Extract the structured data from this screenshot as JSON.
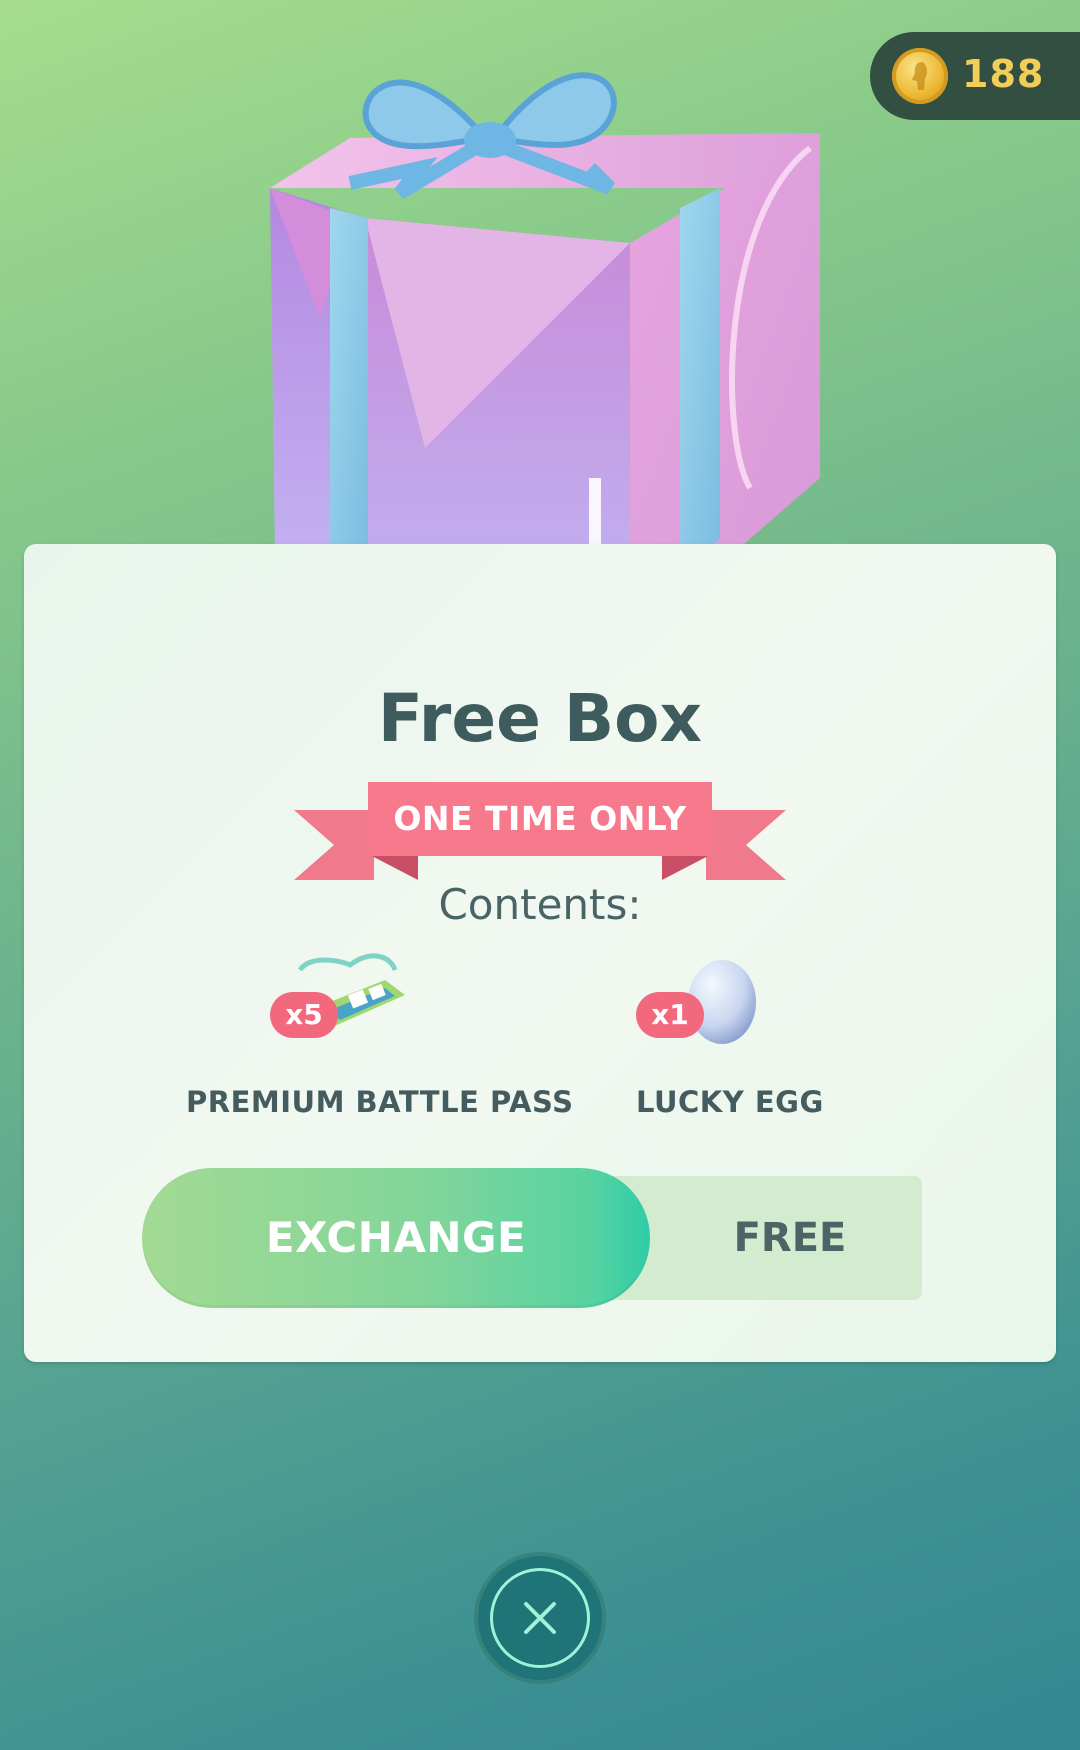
{
  "header": {
    "coins": "188",
    "coin_icon": "pokecoin-icon"
  },
  "offer": {
    "image": "gift-box-illustration",
    "title": "Free Box",
    "banner": "ONE TIME ONLY",
    "contents_label": "Contents:",
    "items": [
      {
        "icon": "battle-pass-icon",
        "quantity": "x5",
        "name": "PREMIUM BATTLE PASS"
      },
      {
        "icon": "lucky-egg-icon",
        "quantity": "x1",
        "name": "LUCKY EGG"
      }
    ]
  },
  "purchase": {
    "exchange_label": "EXCHANGE",
    "price_label": "FREE"
  },
  "close": {
    "icon": "close-icon"
  },
  "colors": {
    "badge": "#f2687c",
    "ribbon": "#f6788a",
    "coin_text": "#f5cf55",
    "exchange_gradient_start": "#a3da93",
    "exchange_gradient_end": "#2fcca8"
  }
}
